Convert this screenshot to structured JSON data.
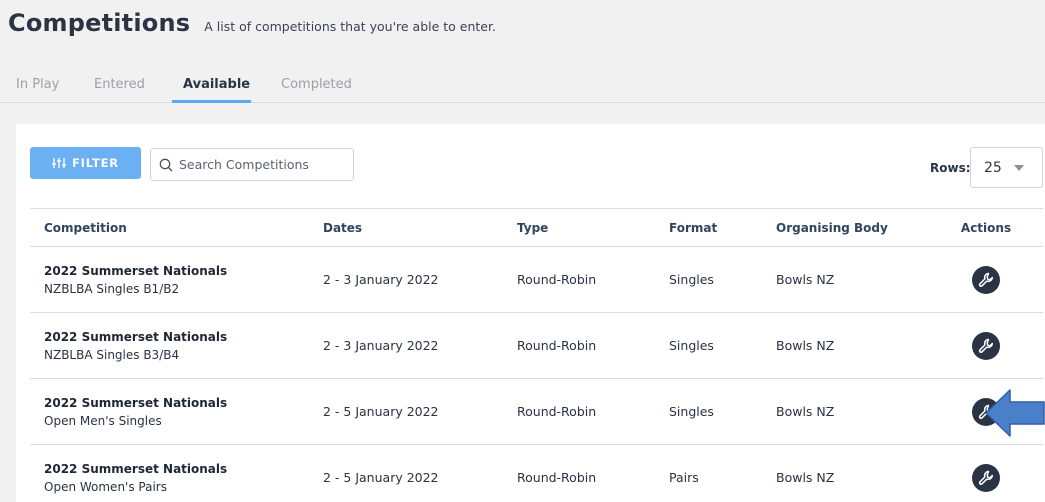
{
  "header": {
    "title": "Competitions",
    "subtitle": "A list of competitions that you're able to enter."
  },
  "tabs": [
    {
      "label": "In Play",
      "active": false
    },
    {
      "label": "Entered",
      "active": false
    },
    {
      "label": "Available",
      "active": true
    },
    {
      "label": "Completed",
      "active": false
    }
  ],
  "toolbar": {
    "filter_label": "FILTER",
    "search_placeholder": "Search Competitions",
    "rows_label": "Rows:",
    "rows_value": "25"
  },
  "table": {
    "columns": [
      "Competition",
      "Dates",
      "Type",
      "Format",
      "Organising Body",
      "Actions"
    ],
    "rows": [
      {
        "name": "2022 Summerset Nationals",
        "event": "NZBLBA Singles B1/B2",
        "dates": "2 - 3 January 2022",
        "type": "Round-Robin",
        "format": "Singles",
        "body": "Bowls NZ"
      },
      {
        "name": "2022 Summerset Nationals",
        "event": "NZBLBA Singles B3/B4",
        "dates": "2 - 3 January 2022",
        "type": "Round-Robin",
        "format": "Singles",
        "body": "Bowls NZ"
      },
      {
        "name": "2022 Summerset Nationals",
        "event": "Open Men's Singles",
        "dates": "2 - 5 January 2022",
        "type": "Round-Robin",
        "format": "Singles",
        "body": "Bowls NZ"
      },
      {
        "name": "2022 Summerset Nationals",
        "event": "Open Women's Pairs",
        "dates": "2 - 5 January 2022",
        "type": "Round-Robin",
        "format": "Pairs",
        "body": "Bowls NZ"
      }
    ]
  },
  "colors": {
    "accent": "#5aa9ef",
    "filter_button": "#6ab0f2",
    "action_button": "#2b3444",
    "annotation_arrow": "#4a7fc9"
  },
  "icons": {
    "filter": "sliders-icon",
    "search": "search-icon",
    "rows_dropdown": "caret-down-icon",
    "action": "wrench-icon",
    "annotation": "arrow-left-icon"
  }
}
